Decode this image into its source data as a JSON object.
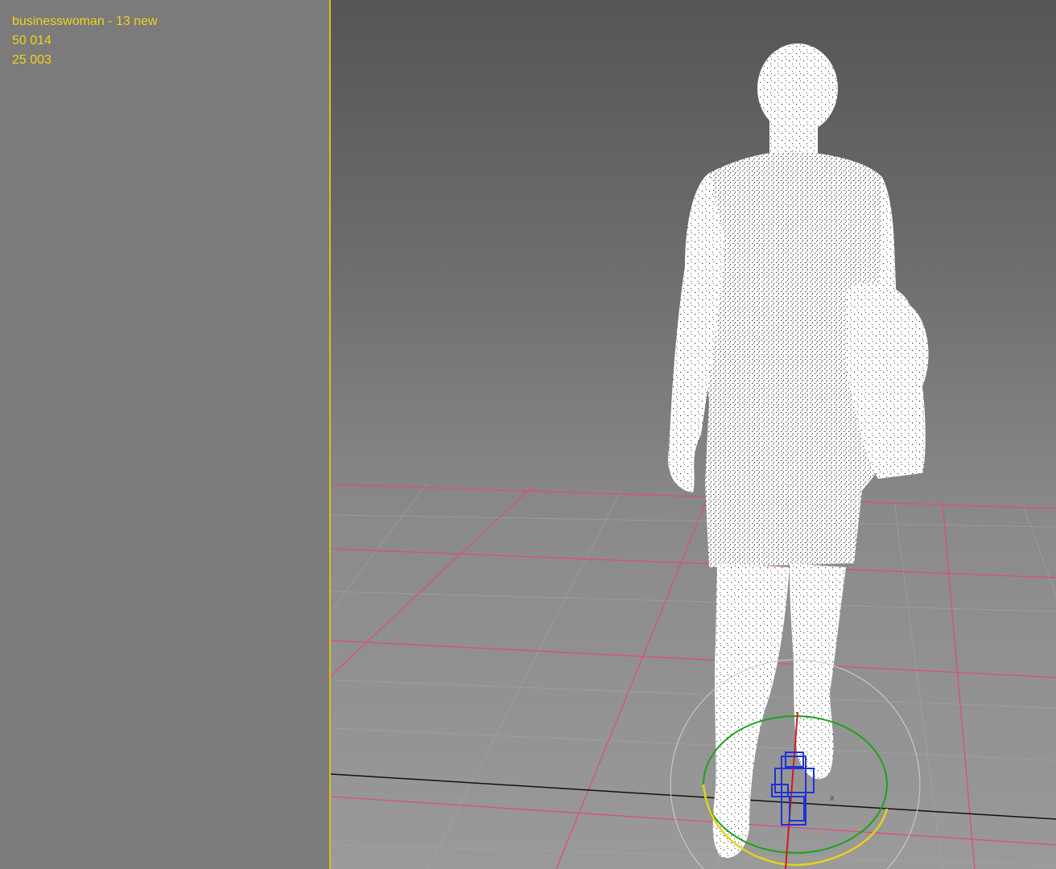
{
  "viewport_stats": {
    "object_name": "businesswoman - 13 new",
    "line2": "50 014",
    "line3": "25 003"
  },
  "colors": {
    "stats_text": "#f2d21a",
    "divider": "#d8c21a",
    "grid_major": "#d9507a",
    "grid_minor": "#a8a8a8",
    "model": "#ffffff",
    "gizmo_blue": "#1e32d6",
    "gizmo_green": "#1aa41a",
    "gizmo_yellow": "#e6d21a",
    "gizmo_red": "#d21a1a"
  },
  "gizmo": {
    "axis_label": "x"
  }
}
